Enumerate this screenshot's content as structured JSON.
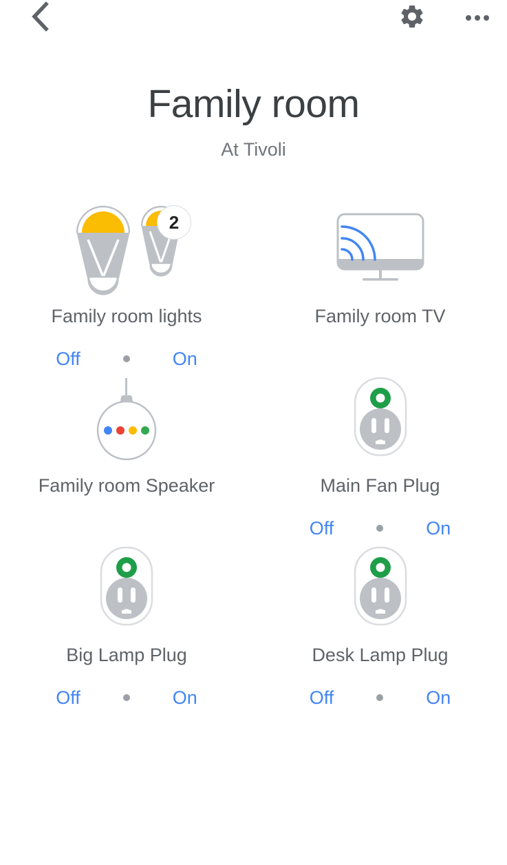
{
  "appbar": {
    "back_icon": "chevron-left-icon",
    "settings_icon": "gear-icon",
    "overflow_icon": "more-horizontal-icon"
  },
  "header": {
    "title": "Family room",
    "subtitle": "At Tivoli"
  },
  "colors": {
    "accent_blue": "#4285f4",
    "text_dark": "#3c4043",
    "text_gray": "#5f6368",
    "text_light_gray": "#70757a",
    "icon_gray": "#bdc1c6",
    "bulb_yellow": "#fbbc04",
    "plug_green": "#1e9e48",
    "dot_blue": "#4285f4",
    "dot_red": "#ea4335",
    "dot_yellow": "#fbbc04",
    "dot_green": "#34a853",
    "separator_gray": "#9aa0a6",
    "background": "#ffffff"
  },
  "devices": [
    {
      "name": "Family room lights",
      "icon": "light-bulbs-icon",
      "badge": "2",
      "has_toggle": true,
      "off_label": "Off",
      "on_label": "On"
    },
    {
      "name": "Family room TV",
      "icon": "cast-tv-icon",
      "badge": null,
      "has_toggle": false,
      "off_label": null,
      "on_label": null
    },
    {
      "name": "Family room Speaker",
      "icon": "smart-speaker-icon",
      "badge": null,
      "has_toggle": false,
      "off_label": null,
      "on_label": null
    },
    {
      "name": "Main Fan Plug",
      "icon": "smart-plug-icon",
      "badge": null,
      "has_toggle": true,
      "off_label": "Off",
      "on_label": "On"
    },
    {
      "name": "Big Lamp Plug",
      "icon": "smart-plug-icon",
      "badge": null,
      "has_toggle": true,
      "off_label": "Off",
      "on_label": "On"
    },
    {
      "name": "Desk Lamp Plug",
      "icon": "smart-plug-icon",
      "badge": null,
      "has_toggle": true,
      "off_label": "Off",
      "on_label": "On"
    }
  ]
}
